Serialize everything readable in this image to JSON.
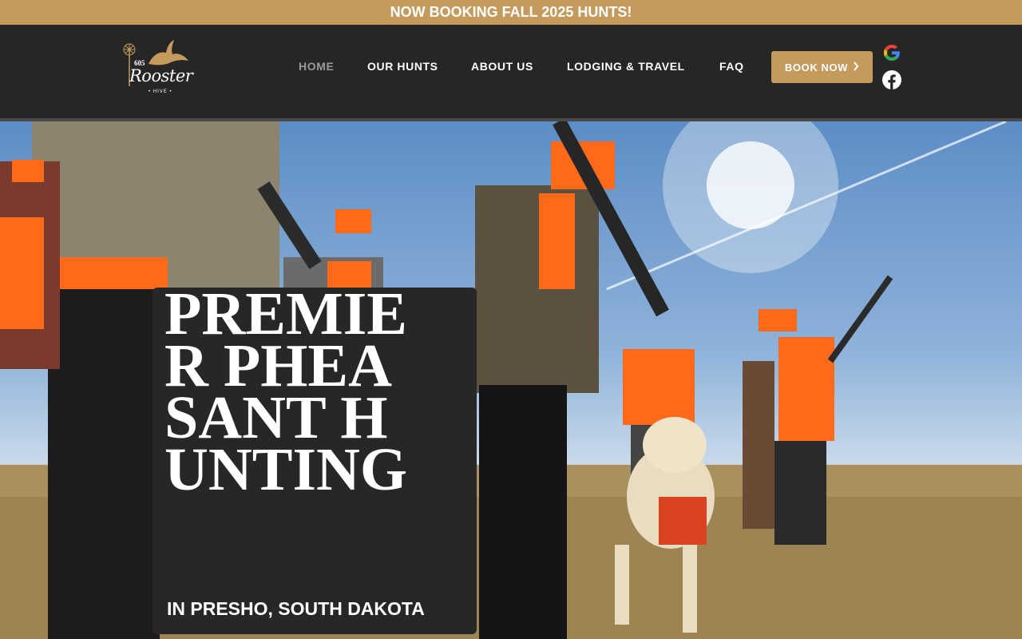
{
  "announcement": {
    "text": "NOW BOOKING FALL 2025 HUNTS!"
  },
  "logo": {
    "number": "605",
    "script": "Rooster",
    "tag": "• HIVE •"
  },
  "nav": {
    "items": [
      {
        "label": "HOME",
        "active": true
      },
      {
        "label": "OUR HUNTS"
      },
      {
        "label": "ABOUT US"
      },
      {
        "label": "LODGING & TRAVEL"
      },
      {
        "label": "FAQ"
      }
    ],
    "book_label": "BOOK NOW"
  },
  "social": [
    "google-icon",
    "facebook-icon"
  ],
  "hero": {
    "headline": "PREMIER PHEASANT HUNTING",
    "subheadline": "IN PRESHO, SOUTH DAKOTA"
  },
  "colors": {
    "gold": "#c49b5c",
    "header_bg": "#262626",
    "headline_bg": "#282627",
    "hunter_orange": "#ff6a1a"
  }
}
